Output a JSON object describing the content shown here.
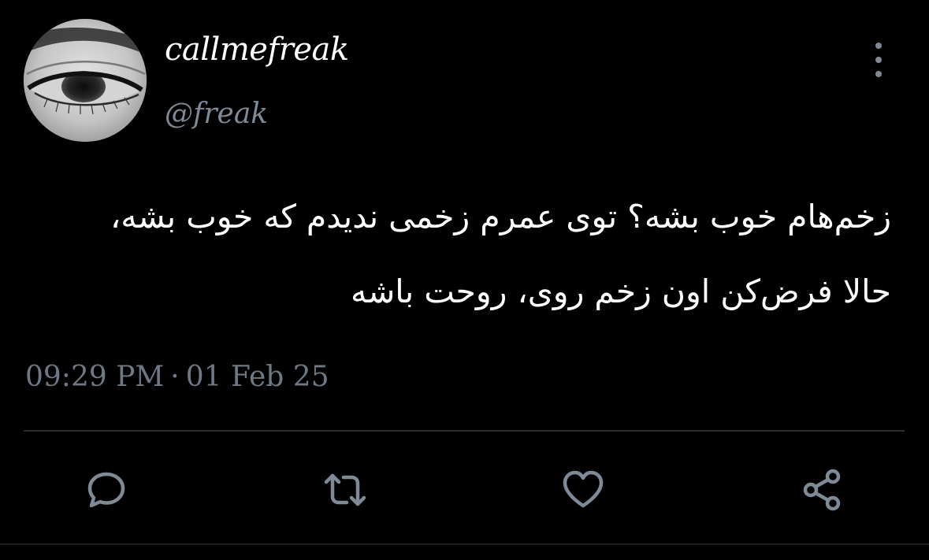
{
  "user": {
    "display_name": "callmefreak",
    "handle": "@freak",
    "avatar_icon": "eye-photo"
  },
  "tweet": {
    "lines": [
      "زخم‌هام خوب بشه؟ توی عمرم زخمی ندیدم که خوب بشه،",
      "حالا فرض‌کن اون زخم روی، روحت باشه"
    ],
    "time": "09:29 PM",
    "separator": "·",
    "date": "01 Feb 25"
  },
  "actions": {
    "reply_icon": "speech-bubble-icon",
    "retweet_icon": "retweet-icon",
    "like_icon": "heart-icon",
    "share_icon": "share-icon"
  },
  "colors": {
    "background": "#000000",
    "text_primary": "#ffffff",
    "text_secondary": "#7f8a97",
    "divider": "#2b2f33"
  }
}
